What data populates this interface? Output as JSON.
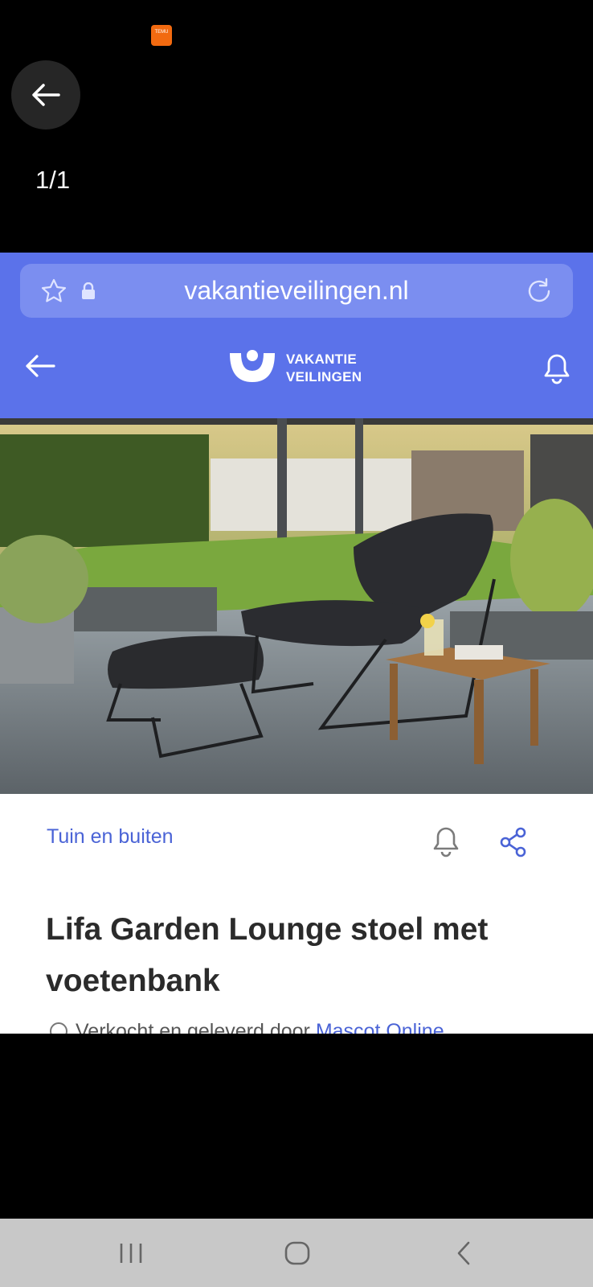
{
  "status": {
    "app_badge_text": "TEMU"
  },
  "viewer": {
    "counter": "1/1"
  },
  "browser": {
    "url": "vakantieveilingen.nl"
  },
  "app_header": {
    "logo_line1": "VAKANTIE",
    "logo_line2": "VEILINGEN"
  },
  "product": {
    "category": "Tuin en buiten",
    "title": "Lifa Garden Lounge stoel met voetenbank",
    "sold_by_prefix": "Verkocht en geleverd door ",
    "sold_by_seller": "Mascot Online"
  },
  "colors": {
    "brand_blue": "#5b72ea",
    "link_blue": "#4a63d6",
    "temu_orange": "#f26a10"
  },
  "icons": [
    "back-arrow-icon",
    "star-icon",
    "lock-icon",
    "reload-icon",
    "bell-icon",
    "share-icon",
    "info-icon"
  ]
}
